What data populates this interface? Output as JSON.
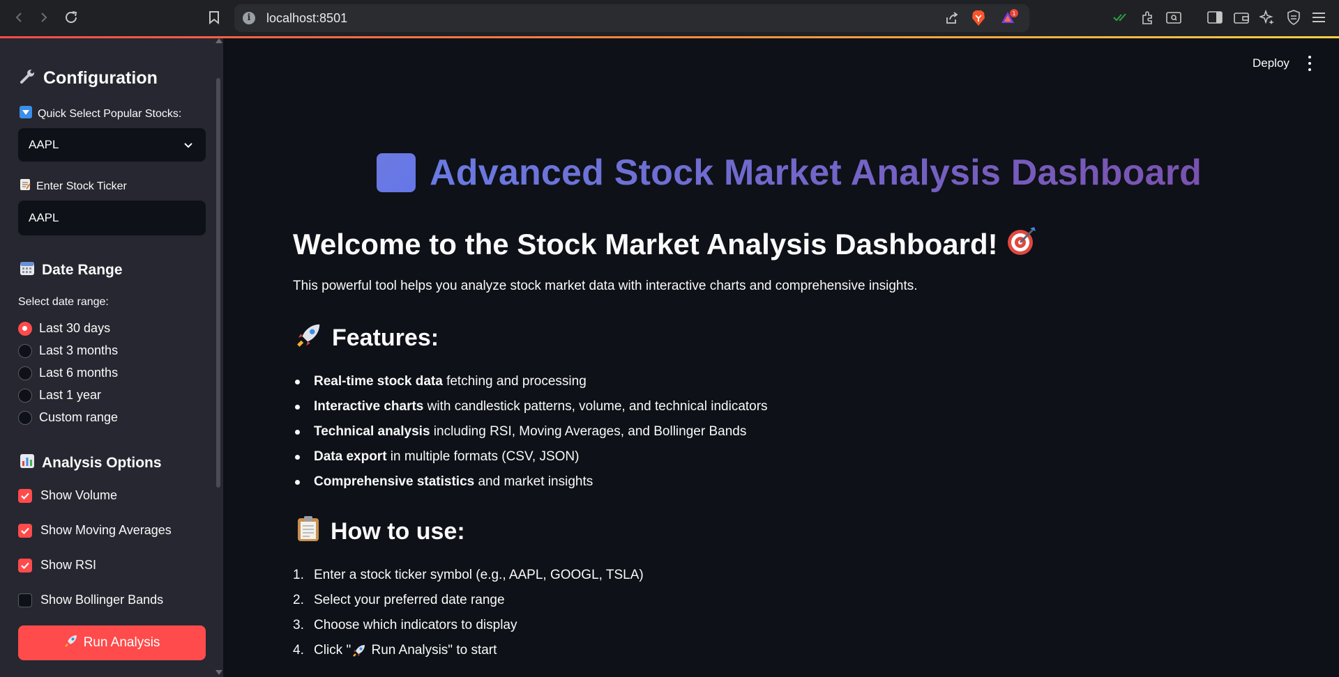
{
  "browser": {
    "url": "localhost:8501",
    "notification_count": "1"
  },
  "sidebar": {
    "heading": "Configuration",
    "quick_select_label": "Quick Select Popular Stocks:",
    "quick_select_value": "AAPL",
    "ticker_label": "Enter Stock Ticker",
    "ticker_value": "AAPL",
    "date_heading": "Date Range",
    "date_label": "Select date range:",
    "date_options": [
      {
        "label": "Last 30 days",
        "selected": true
      },
      {
        "label": "Last 3 months",
        "selected": false
      },
      {
        "label": "Last 6 months",
        "selected": false
      },
      {
        "label": "Last 1 year",
        "selected": false
      },
      {
        "label": "Custom range",
        "selected": false
      }
    ],
    "analysis_heading": "Analysis Options",
    "options": [
      {
        "label": "Show Volume",
        "checked": true
      },
      {
        "label": "Show Moving Averages",
        "checked": true
      },
      {
        "label": "Show RSI",
        "checked": true
      },
      {
        "label": "Show Bollinger Bands",
        "checked": false
      }
    ],
    "run_button": "Run Analysis"
  },
  "main": {
    "deploy": "Deploy",
    "title": "Advanced Stock Market Analysis Dashboard",
    "welcome": "Welcome to the Stock Market Analysis Dashboard!",
    "intro": "This powerful tool helps you analyze stock market data with interactive charts and comprehensive insights.",
    "features_heading": "Features:",
    "features": [
      {
        "bold": "Real-time stock data",
        "text": " fetching and processing"
      },
      {
        "bold": "Interactive charts",
        "text": " with candlestick patterns, volume, and technical indicators"
      },
      {
        "bold": "Technical analysis",
        "text": " including RSI, Moving Averages, and Bollinger Bands"
      },
      {
        "bold": "Data export",
        "text": " in multiple formats (CSV, JSON)"
      },
      {
        "bold": "Comprehensive statistics",
        "text": " and market insights"
      }
    ],
    "howto_heading": "How to use:",
    "steps": [
      {
        "num": "1.",
        "text": "Enter a stock ticker symbol (e.g., AAPL, GOOGL, TSLA)"
      },
      {
        "num": "2.",
        "text": "Select your preferred date range"
      },
      {
        "num": "3.",
        "text": "Choose which indicators to display"
      },
      {
        "num": "4.",
        "pre": "Click \"",
        "post": " Run Analysis\" to start"
      }
    ]
  },
  "colors": {
    "accent": "#ff4b4b",
    "sidebar_bg": "#262730",
    "main_bg": "#0e1117",
    "title_gradient_start": "#6a7ae2",
    "title_gradient_end": "#7a52b0"
  },
  "icons": {
    "configuration": "wrench-icon",
    "quick_select": "down-arrow-button-icon",
    "ticker": "memo-icon",
    "date_range": "calendar-icon",
    "analysis": "bar-chart-icon",
    "run": "rocket-icon",
    "title": "blue-square-icon",
    "welcome": "target-icon",
    "features": "rocket-icon",
    "howto": "clipboard-icon"
  }
}
